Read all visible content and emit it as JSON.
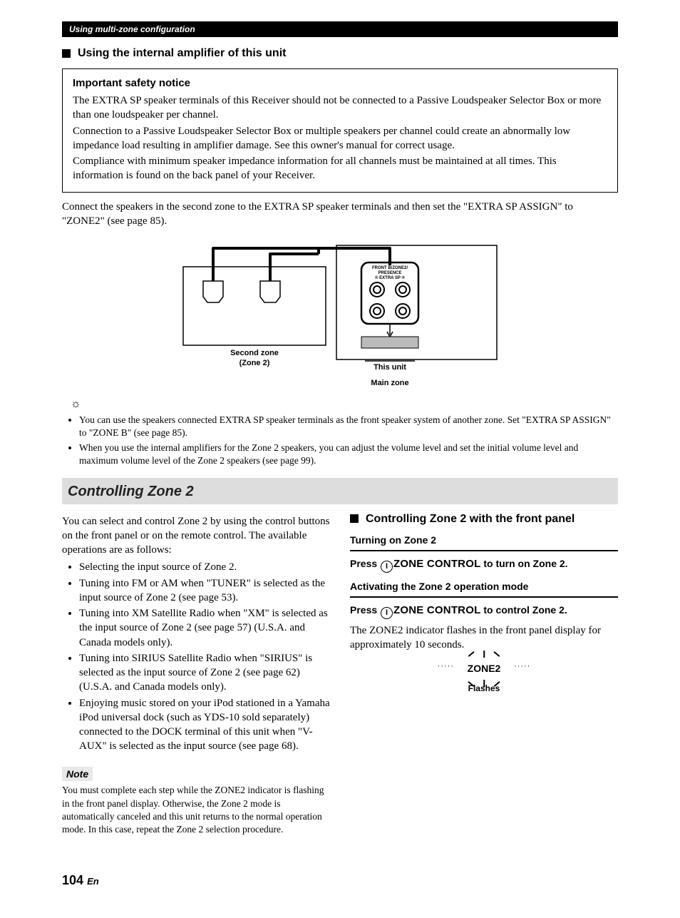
{
  "header_bar": "Using multi-zone configuration",
  "h2_internal_amp": "Using the internal amplifier of this unit",
  "notice": {
    "title": "Important safety notice",
    "p1": "The EXTRA SP speaker terminals of this Receiver should not be connected to a Passive Loudspeaker Selector Box or more than one loudspeaker per channel.",
    "p2": "Connection to a Passive Loudspeaker Selector Box or multiple speakers per channel could create an abnormally low impedance load resulting in amplifier damage. See this owner's manual for correct usage.",
    "p3": "Compliance with minimum speaker impedance information for all channels must be maintained at all times. This information is found on the back panel of your Receiver."
  },
  "connect_text": "Connect the speakers in the second zone to the EXTRA SP speaker terminals and then set the \"EXTRA SP ASSIGN\" to \"ZONE2\" (see page 85).",
  "diagram": {
    "second_zone_line1": "Second zone",
    "second_zone_line2": "(Zone 2)",
    "this_unit": "This unit",
    "main_zone": "Main zone",
    "panel_line1": "FRONT B/ZONE2/",
    "panel_line2": "PRESENCE",
    "panel_line3": "® EXTRA SP ®"
  },
  "tips": [
    "You can use the speakers connected EXTRA SP speaker terminals as the front speaker system of another zone. Set \"EXTRA SP ASSIGN\" to \"ZONE B\" (see page 85).",
    "When you use the internal amplifiers for the Zone 2 speakers, you can adjust the volume level and set the initial volume level and maximum volume level of the Zone 2 speakers (see page 99)."
  ],
  "section_banner": "Controlling Zone 2",
  "left": {
    "intro": "You can select and control Zone 2 by using the control buttons on the front panel or on the remote control. The available operations are as follows:",
    "ops": [
      "Selecting the input source of Zone 2.",
      "Tuning into FM or AM when \"TUNER\" is selected as the input source of Zone 2 (see page 53).",
      "Tuning into XM Satellite Radio when \"XM\" is selected as the input source of Zone 2 (see page 57) (U.S.A. and Canada models only).",
      "Tuning into SIRIUS Satellite Radio when \"SIRIUS\" is selected as the input source of Zone 2 (see page 62) (U.S.A. and Canada models only).",
      "Enjoying music stored on your iPod stationed in a Yamaha iPod universal dock (such as YDS-10 sold separately) connected to the DOCK terminal of this unit when \"V-AUX\" is selected as the input source (see page 68)."
    ],
    "note_label": "Note",
    "note_text": "You must complete each step while the ZONE2 indicator is flashing in the front panel display. Otherwise, the Zone 2 mode is automatically canceled and this unit returns to the normal operation mode. In this case, repeat the Zone 2 selection procedure."
  },
  "right": {
    "h2": "Controlling Zone 2 with the front panel",
    "sub1": "Turning on Zone 2",
    "instr1_prefix": "Press ",
    "instr1_step": "I",
    "instr1_bold": "ZONE CONTROL",
    "instr1_suffix": " to turn on Zone 2.",
    "sub2": "Activating the Zone 2 operation mode",
    "instr2_prefix": "Press ",
    "instr2_step": "I",
    "instr2_bold": "ZONE CONTROL",
    "instr2_suffix": " to control Zone 2.",
    "body": "The ZONE2 indicator flashes in the front panel display for approximately 10 seconds.",
    "flash_zone2": "ZONE2",
    "flash_label": "Flashes"
  },
  "page_number": "104",
  "page_lang": "En"
}
